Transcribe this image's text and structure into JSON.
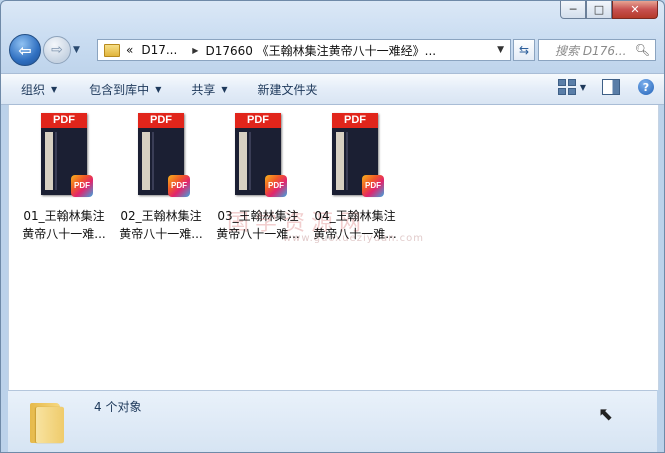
{
  "window": {
    "caption": {
      "minimize": "─",
      "maximize": "□",
      "close": "✕"
    }
  },
  "nav": {
    "back_icon": "back-arrow-icon",
    "forward_icon": "forward-arrow-icon",
    "breadcrumb_overflow": "«",
    "breadcrumb": [
      "D17...",
      "D17660 《王翰林集注黄帝八十一难经》..."
    ],
    "search_placeholder": "搜索 D176..."
  },
  "toolbar": {
    "organize": "组织",
    "include_in_library": "包含到库中",
    "share": "共享",
    "new_folder": "新建文件夹"
  },
  "files": [
    {
      "line1": "01_王翰林集注",
      "line2": "黄帝八十一难...",
      "type_label": "PDF",
      "badge": "PDF"
    },
    {
      "line1": "02_王翰林集注",
      "line2": "黄帝八十一难...",
      "type_label": "PDF",
      "badge": "PDF"
    },
    {
      "line1": "03_王翰林集注",
      "line2": "黄帝八十一难...",
      "type_label": "PDF",
      "badge": "PDF"
    },
    {
      "line1": "04_王翰林集注",
      "line2": "黄帝八十一难...",
      "type_label": "PDF",
      "badge": "PDF"
    }
  ],
  "watermark": {
    "text": "国学资源网",
    "url": "www.guoxueziyuan.com"
  },
  "status": {
    "count": "4 个对象"
  },
  "colors": {
    "pdf_red": "#e1251b",
    "toolbar_text": "#1e395b"
  }
}
